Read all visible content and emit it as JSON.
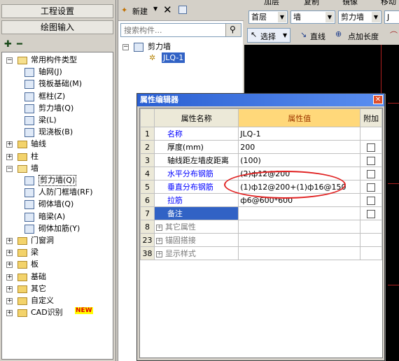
{
  "left_panel": {
    "btn_project_settings": "工程设置",
    "btn_drawing_input": "绘图输入",
    "tree": [
      {
        "label": "常用构件类型",
        "type": "folder",
        "expanded": true,
        "icon": "folder-open-icon"
      },
      {
        "label": "轴网(J)",
        "type": "leaf",
        "icon": "grid-icon"
      },
      {
        "label": "筏板基础(M)",
        "type": "leaf",
        "icon": "raft-foundation-icon"
      },
      {
        "label": "框柱(Z)",
        "type": "leaf",
        "icon": "column-icon"
      },
      {
        "label": "剪力墙(Q)",
        "type": "leaf",
        "icon": "shear-wall-icon"
      },
      {
        "label": "梁(L)",
        "type": "leaf",
        "icon": "beam-icon"
      },
      {
        "label": "现浇板(B)",
        "type": "leaf",
        "icon": "slab-icon"
      },
      {
        "label": "轴线",
        "type": "folder"
      },
      {
        "label": "柱",
        "type": "folder"
      },
      {
        "label": "墙",
        "type": "folder",
        "expanded": true
      },
      {
        "label": "剪力墙(Q)",
        "type": "leaf",
        "selected": true,
        "icon": "shear-wall-icon"
      },
      {
        "label": "人防门框墙(RF)",
        "type": "leaf",
        "icon": "door-frame-wall-icon"
      },
      {
        "label": "砌体墙(Q)",
        "type": "leaf",
        "icon": "masonry-wall-icon"
      },
      {
        "label": "暗梁(A)",
        "type": "leaf",
        "icon": "hidden-beam-icon"
      },
      {
        "label": "砌体加筋(Y)",
        "type": "leaf",
        "icon": "masonry-rebar-icon"
      },
      {
        "label": "门窗洞",
        "type": "folder"
      },
      {
        "label": "梁",
        "type": "folder"
      },
      {
        "label": "板",
        "type": "folder"
      },
      {
        "label": "基础",
        "type": "folder"
      },
      {
        "label": "其它",
        "type": "folder"
      },
      {
        "label": "自定义",
        "type": "folder"
      },
      {
        "label": "CAD识别",
        "type": "folder",
        "badge": "NEW"
      }
    ]
  },
  "middle_panel": {
    "new_label": "新建",
    "search_placeholder": "搜索构件...",
    "tree_root": "剪力墙",
    "tree_child": "JLQ-1"
  },
  "right_toolbar": {
    "top_items": [
      "加层",
      "复制",
      "镜像",
      "移动"
    ],
    "floor": "首层",
    "category": "墙",
    "type": "剪力墙",
    "element": "J",
    "select_label": "选择",
    "line_label": "直线",
    "point_length_label": "点加长度"
  },
  "dialog": {
    "title": "属性编辑器",
    "headers": {
      "name": "属性名称",
      "value": "属性值",
      "extra": "附加"
    },
    "rows": [
      {
        "num": "1",
        "name": "名称",
        "value": "JLQ-1",
        "style": "blue",
        "check": false
      },
      {
        "num": "2",
        "name": "厚度(mm)",
        "value": "200",
        "style": "normal",
        "check": true
      },
      {
        "num": "3",
        "name": "轴线距左墙皮距离",
        "value": "(100)",
        "style": "normal",
        "check": true
      },
      {
        "num": "4",
        "name": "水平分布钢筋",
        "value": "(2)ф12@200",
        "style": "blue",
        "check": true
      },
      {
        "num": "5",
        "name": "垂直分布钢筋",
        "value": "(1)ф12@200+(1)ф16@150",
        "style": "blue",
        "check": true
      },
      {
        "num": "6",
        "name": "拉筋",
        "value": "ф6@600*600",
        "style": "blue",
        "check": true
      },
      {
        "num": "7",
        "name": "备注",
        "value": "",
        "style": "selected",
        "check": true
      },
      {
        "num": "8",
        "name": "其它属性",
        "value": "",
        "style": "group",
        "check": false
      },
      {
        "num": "23",
        "name": "锚固搭接",
        "value": "",
        "style": "group",
        "check": false
      },
      {
        "num": "38",
        "name": "显示样式",
        "value": "",
        "style": "group",
        "check": false
      }
    ]
  },
  "colors": {
    "title_bar": "#2a5fd2",
    "header_value_bg": "#ffd87a",
    "highlight_ellipse": "#e02020",
    "canvas": "#000000"
  }
}
